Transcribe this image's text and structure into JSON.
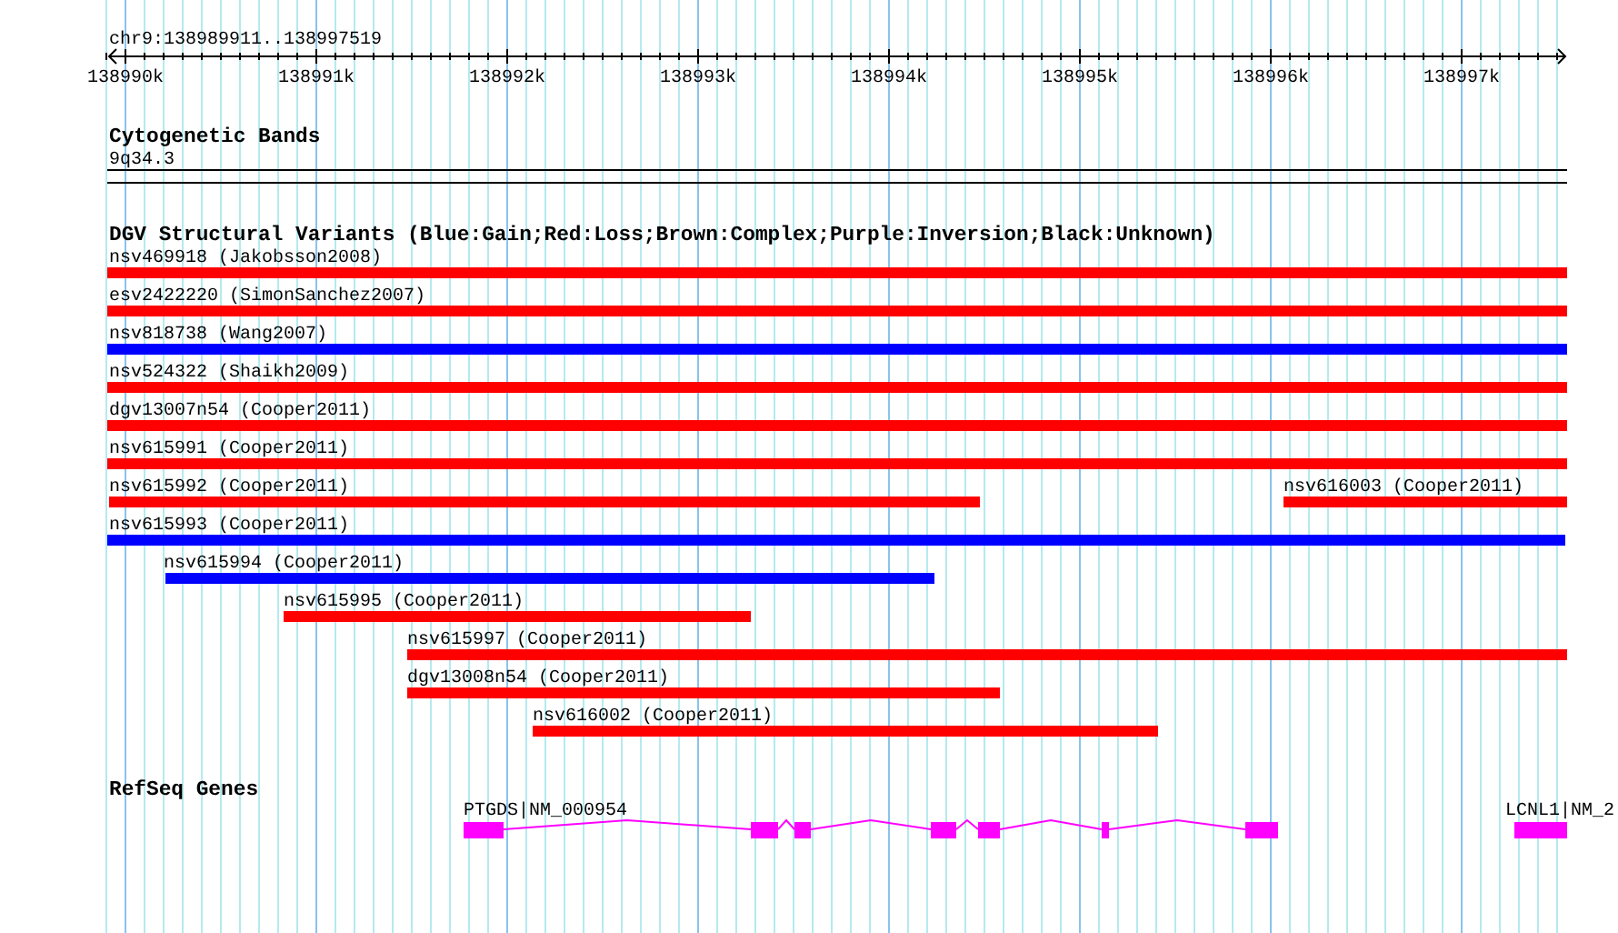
{
  "location": "chr9:138989911..138997519",
  "ruler": {
    "ticks": [
      "138990k",
      "138991k",
      "138992k",
      "138993k",
      "138994k",
      "138995k",
      "138996k",
      "138997k"
    ]
  },
  "bands": {
    "title": "Cytogenetic Bands",
    "features": [
      {
        "label": "9q34.3"
      }
    ]
  },
  "variants": {
    "title": "DGV Structural Variants (Blue:Gain;Red:Loss;Brown:Complex;Purple:Inversion;Black:Unknown)",
    "features": [
      {
        "label": "nsv469918 (Jakobsson2008)",
        "color": "#ff0000"
      },
      {
        "label": "esv2422220 (SimonSanchez2007)",
        "color": "#ff0000"
      },
      {
        "label": "nsv818738 (Wang2007)",
        "color": "#0000ff"
      },
      {
        "label": "nsv524322 (Shaikh2009)",
        "color": "#ff0000"
      },
      {
        "label": "dgv13007n54 (Cooper2011)",
        "color": "#ff0000"
      },
      {
        "label": "nsv615991 (Cooper2011)",
        "color": "#ff0000"
      },
      {
        "label": "nsv615992 (Cooper2011)",
        "color": "#ff0000"
      },
      {
        "label": "nsv616003 (Cooper2011)",
        "color": "#ff0000"
      },
      {
        "label": "nsv615993 (Cooper2011)",
        "color": "#0000ff"
      },
      {
        "label": "nsv615994 (Cooper2011)",
        "color": "#0000ff"
      },
      {
        "label": "nsv615995 (Cooper2011)",
        "color": "#ff0000"
      },
      {
        "label": "nsv615997 (Cooper2011)",
        "color": "#ff0000"
      },
      {
        "label": "dgv13008n54 (Cooper2011)",
        "color": "#ff0000"
      },
      {
        "label": "nsv616002 (Cooper2011)",
        "color": "#ff0000"
      }
    ]
  },
  "genes": {
    "title": "RefSeq Genes",
    "features": [
      {
        "label": "PTGDS|NM_000954"
      },
      {
        "label": "LCNL1|NM_2"
      }
    ]
  }
}
